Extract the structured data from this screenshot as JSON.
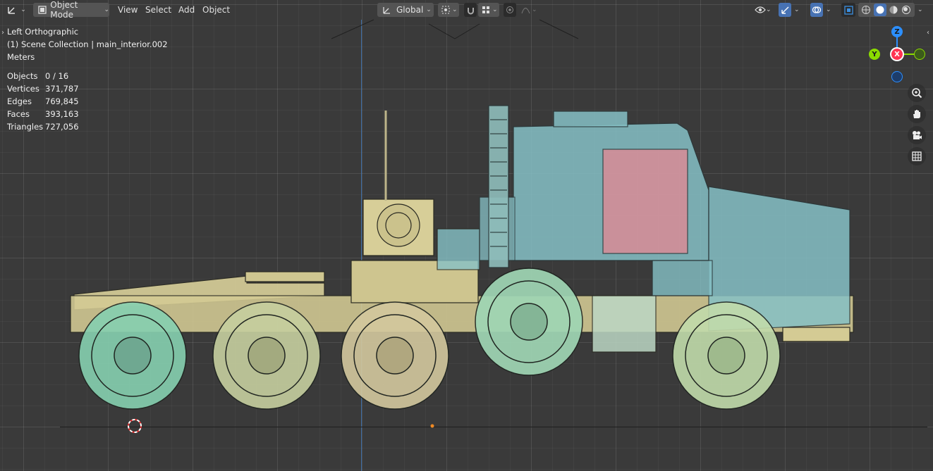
{
  "header": {
    "editor_type_icon": "axis-transform-icon",
    "mode_label": "Object Mode",
    "menus": [
      "View",
      "Select",
      "Add",
      "Object"
    ],
    "orientation_label": "Global",
    "pivot_icon": "pivot-point-icon",
    "snap_icon": "snap-grid-icon",
    "proportional_icon": "proportional-edit-icon",
    "visibility_icon": "eye-icon",
    "gizmo_icon": "gizmo-icon",
    "overlay_icon": "overlay-icon",
    "xray_icon": "xray-icon",
    "shading_modes": [
      "wireframe",
      "solid",
      "material-preview",
      "rendered"
    ],
    "active_shading": "solid"
  },
  "viewport": {
    "view_name": "Left Orthographic",
    "collection_line": "(1) Scene Collection | main_interior.002",
    "units": "Meters"
  },
  "stats": [
    {
      "label": "Objects",
      "value": "0 / 16"
    },
    {
      "label": "Vertices",
      "value": "371,787"
    },
    {
      "label": "Edges",
      "value": "769,845"
    },
    {
      "label": "Faces",
      "value": "393,163"
    },
    {
      "label": "Triangles",
      "value": "727,056"
    }
  ],
  "gizmo": {
    "z": "Z",
    "y": "Y",
    "x": "X"
  },
  "nav_buttons": [
    "zoom-icon",
    "hand-pan-icon",
    "camera-icon",
    "grid-ortho-icon"
  ],
  "colors": {
    "background": "#393939",
    "x_axis": "#ff3352",
    "y_axis": "#8bdc00",
    "z_axis": "#2c8fff",
    "active_blue": "#4772b3",
    "chassis": "#d9d09a",
    "cab": "#86c1c6",
    "wheels": "#86d0b0"
  }
}
